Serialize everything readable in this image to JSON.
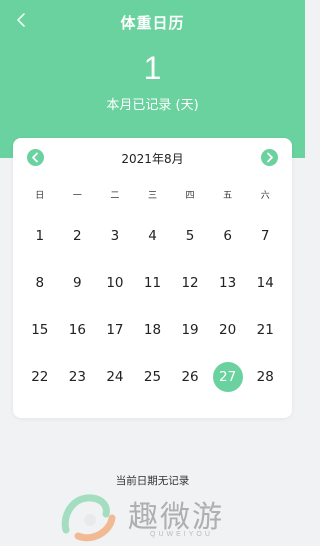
{
  "header": {
    "title": "体重日历",
    "record_count": "1",
    "record_label": "本月已记录 (天)"
  },
  "calendar": {
    "month_title": "2021年8月",
    "weekdays": [
      "日",
      "一",
      "二",
      "三",
      "四",
      "五",
      "六"
    ],
    "days": [
      "1",
      "2",
      "3",
      "4",
      "5",
      "6",
      "7",
      "8",
      "9",
      "10",
      "11",
      "12",
      "13",
      "14",
      "15",
      "16",
      "17",
      "18",
      "19",
      "20",
      "21",
      "22",
      "23",
      "24",
      "25",
      "26",
      "27",
      "28"
    ],
    "selected_day": "27"
  },
  "status": {
    "no_record_text": "当前日期无记录"
  },
  "watermark": {
    "text": "趣微游",
    "sub": "QUWEIYOU"
  },
  "colors": {
    "accent": "#6ad29e",
    "background": "#f1f2f4"
  },
  "icons": {
    "back": "chevron-left-icon",
    "prev": "chevron-left-circle-icon",
    "next": "chevron-right-circle-icon"
  }
}
